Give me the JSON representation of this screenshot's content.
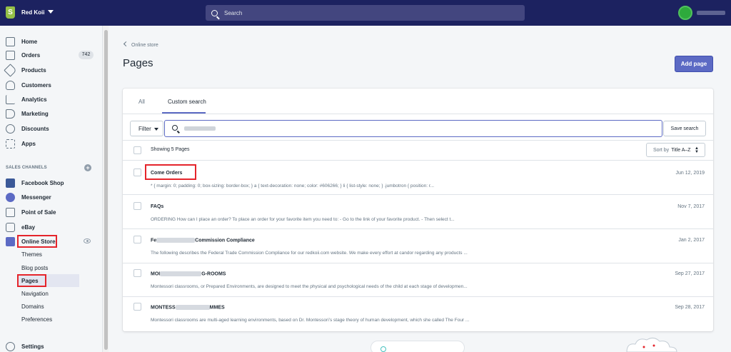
{
  "header": {
    "logo_letter": "S",
    "store_name": "Red Koii",
    "search_placeholder": "Search"
  },
  "sidebar": {
    "items": [
      {
        "label": "Home",
        "icon": "home-icon"
      },
      {
        "label": "Orders",
        "icon": "orders-icon",
        "badge": "742"
      },
      {
        "label": "Products",
        "icon": "tag-icon"
      },
      {
        "label": "Customers",
        "icon": "person-icon"
      },
      {
        "label": "Analytics",
        "icon": "chart-icon"
      },
      {
        "label": "Marketing",
        "icon": "megaphone-icon"
      },
      {
        "label": "Discounts",
        "icon": "discount-icon"
      },
      {
        "label": "Apps",
        "icon": "apps-icon"
      }
    ],
    "sales_channels_title": "SALES CHANNELS",
    "channels": [
      {
        "label": "Facebook Shop",
        "icon": "facebook-icon",
        "color": "#3b5998"
      },
      {
        "label": "Messenger",
        "icon": "messenger-icon",
        "color": "#0084ff"
      },
      {
        "label": "Point of Sale",
        "icon": "pos-icon"
      },
      {
        "label": "eBay",
        "icon": "ebay-icon"
      },
      {
        "label": "Online Store",
        "icon": "store-icon",
        "color": "#5c6ac4"
      }
    ],
    "online_store_sub": [
      "Themes",
      "Blog posts",
      "Pages",
      "Navigation",
      "Domains",
      "Preferences"
    ],
    "settings_label": "Settings"
  },
  "main": {
    "breadcrumb": "Online store",
    "title": "Pages",
    "add_button": "Add page",
    "tabs": [
      "All",
      "Custom search"
    ],
    "filter_label": "Filter",
    "save_search_label": "Save search",
    "showing": "Showing 5 Pages",
    "sort_prefix": "Sort by",
    "sort_value": "Title A–Z",
    "rows": [
      {
        "title": "Come Orders",
        "excerpt": "* { margin: 0; padding: 0; box-sizing: border-box; } a { text-decoration: none; color: #606266; } li { list-style: none; } .jumbotron { position: r...",
        "date": "Jun 12, 2019"
      },
      {
        "title": "FAQs",
        "excerpt": "ORDERING How can I place an order? To place an order for your favorite item you need to: - Go to the link of your favorite product. - Then select t...",
        "date": "Nov 7, 2017"
      },
      {
        "title_start": "Fe",
        "title_end": "Commission Compliance",
        "excerpt": "The following describes the Federal Trade Commission Compliance for our redkoii.com website. We make every effort at candor regarding any products ...",
        "date": "Jan 2, 2017"
      },
      {
        "title_start": "MOI",
        "title_end": "G-ROOMS",
        "excerpt": "Montessori classrooms, or Prepared Environments, are designed to meet the physical and psychological needs of the child at each stage of developmen...",
        "date": "Sep 27, 2017"
      },
      {
        "title_start": "MONTESS",
        "title_end": "MMES",
        "excerpt": "Montessori classrooms are multi-aged learning environments, based on Dr. Montessori’s stage theory of human development, which she called The Four ...",
        "date": "Sep 28, 2017"
      }
    ]
  },
  "colors": {
    "topbar": "#1c2260",
    "primary": "#5c6ac4",
    "highlight": "#e5242b"
  }
}
